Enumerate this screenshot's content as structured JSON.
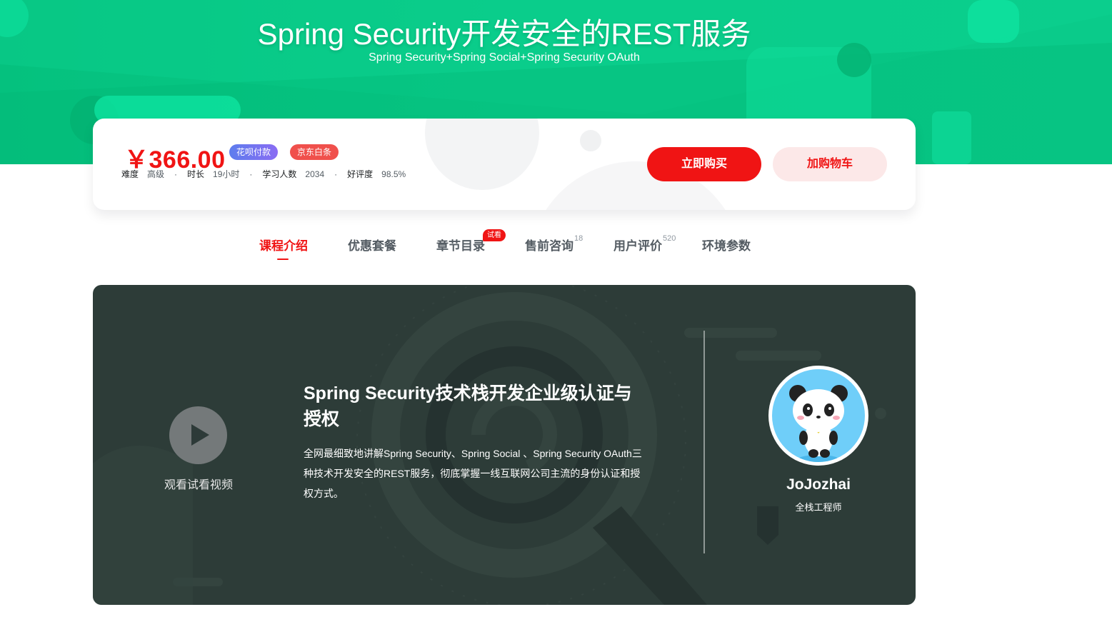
{
  "banner": {
    "title": "Spring Security开发安全的REST服务",
    "subtitle": "Spring Security+Spring Social+Spring Security OAuth"
  },
  "purchase": {
    "price": "￥366.00",
    "badges": [
      "花呗付款",
      "京东白条"
    ],
    "meta": [
      {
        "key": "难度",
        "value": "高级"
      },
      {
        "key": "时长",
        "value": "19小时"
      },
      {
        "key": "学习人数",
        "value": "2034"
      },
      {
        "key": "好评度",
        "value": "98.5%"
      }
    ],
    "buy_label": "立即购买",
    "cart_label": "加购物车"
  },
  "tabs": [
    {
      "label": "课程介绍",
      "active": true
    },
    {
      "label": "优惠套餐"
    },
    {
      "label": "章节目录",
      "tag": "试看"
    },
    {
      "label": "售前咨询",
      "count": "18"
    },
    {
      "label": "用户评价",
      "count": "520"
    },
    {
      "label": "环境参数"
    }
  ],
  "intro": {
    "play_label": "观看试看视频",
    "course_title": "Spring Security技术栈开发企业级认证与授权",
    "course_desc": "全网最细致地讲解Spring Security、Spring Social 、Spring Security OAuth三种技术开发安全的REST服务，彻底掌握一线互联网公司主流的身份认证和授权方式。",
    "teacher_name": "JoJozhai",
    "teacher_role": "全栈工程师"
  },
  "colors": {
    "brand_red": "#f01414",
    "banner_green": "#08c987",
    "panel_bg": "#2d3c38"
  }
}
